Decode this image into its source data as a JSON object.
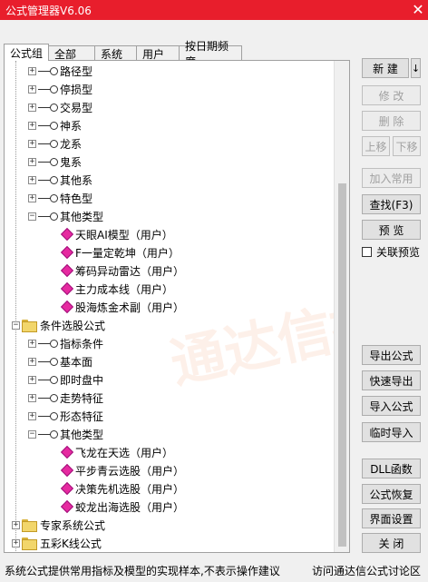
{
  "window": {
    "title": "公式管理器V6.06"
  },
  "tabs": [
    "公式组",
    "全部",
    "系统",
    "用户",
    "按日期频度"
  ],
  "tree": {
    "group1_items": [
      "路径型",
      "停损型",
      "交易型",
      "神系",
      "龙系",
      "鬼系",
      "其他系",
      "特色型",
      "其他类型"
    ],
    "group1_leaves": [
      "天眼AI模型（用户）",
      "F一量定乾坤（用户）",
      "筹码异动雷达（用户）",
      "主力成本线（用户）",
      "股海炼金术副（用户）"
    ],
    "folder_xuangu": "条件选股公式",
    "group2_items": [
      "指标条件",
      "基本面",
      "即时盘中",
      "走势特征",
      "形态特征",
      "其他类型"
    ],
    "group2_leaves": [
      "飞龙在天选（用户）",
      "平步青云选股（用户）",
      "决策先机选股（用户）",
      "蛟龙出海选股（用户）"
    ],
    "folder_zhuanjia": "专家系统公式",
    "folder_wucai": "五彩K线公式"
  },
  "buttons": {
    "new": "新 建",
    "new_dropdown": "↓",
    "modify": "修 改",
    "delete": "删 除",
    "move_up": "上移",
    "move_down": "下移",
    "add_common": "加入常用",
    "find": "查找(F3)",
    "preview": "预 览",
    "link_preview": "关联预览",
    "export": "导出公式",
    "quick_export": "快速导出",
    "import": "导入公式",
    "temp_import": "临时导入",
    "dll": "DLL函数",
    "restore": "公式恢复",
    "ui_settings": "界面设置",
    "close": "关 闭"
  },
  "status": {
    "left": "系统公式提供常用指标及模型的实现样本,不表示操作建议",
    "right": "访问通达信公式讨论区"
  },
  "watermark": "通达信指标",
  "colors": {
    "titlebar": "#e81e2c",
    "leaf_icon": "#e62aa0"
  }
}
